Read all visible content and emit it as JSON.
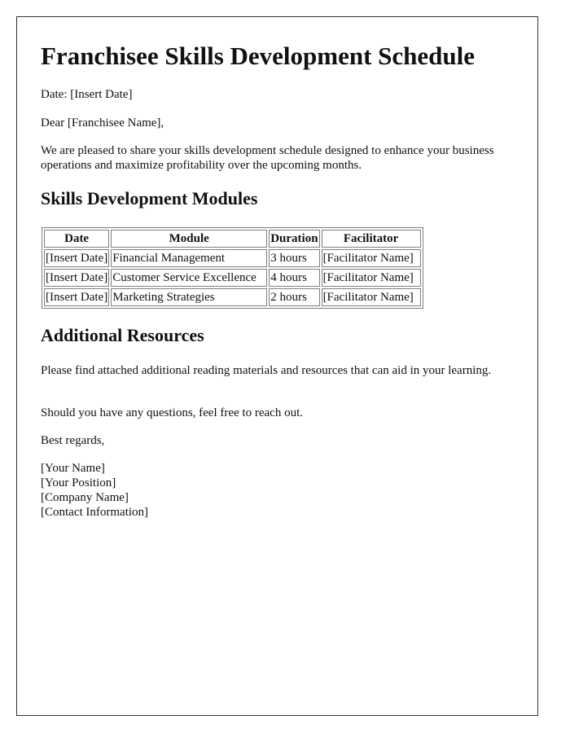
{
  "document": {
    "title": "Franchisee Skills Development Schedule",
    "date_line": "Date: [Insert Date]",
    "salutation": "Dear [Franchisee Name],",
    "intro": "We are pleased to share your skills development schedule designed to enhance your business operations and maximize profitability over the upcoming months.",
    "modules_section": {
      "heading": "Skills Development Modules",
      "table": {
        "headers": [
          "Date",
          "Module",
          "Duration",
          "Facilitator"
        ],
        "rows": [
          [
            "[Insert Date]",
            "Financial Management",
            "3 hours",
            "[Facilitator Name]"
          ],
          [
            "[Insert Date]",
            "Customer Service Excellence",
            "4 hours",
            "[Facilitator Name]"
          ],
          [
            "[Insert Date]",
            "Marketing Strategies",
            "2 hours",
            "[Facilitator Name]"
          ]
        ]
      }
    },
    "resources_section": {
      "heading": "Additional Resources",
      "body": "Please find attached additional reading materials and resources that can aid in your learning."
    },
    "questions_line": "Should you have any questions, feel free to reach out.",
    "closing": "Best regards,",
    "signature": {
      "name": "[Your Name]",
      "position": "[Your Position]",
      "company": "[Company Name]",
      "contact": "[Contact Information]"
    }
  }
}
